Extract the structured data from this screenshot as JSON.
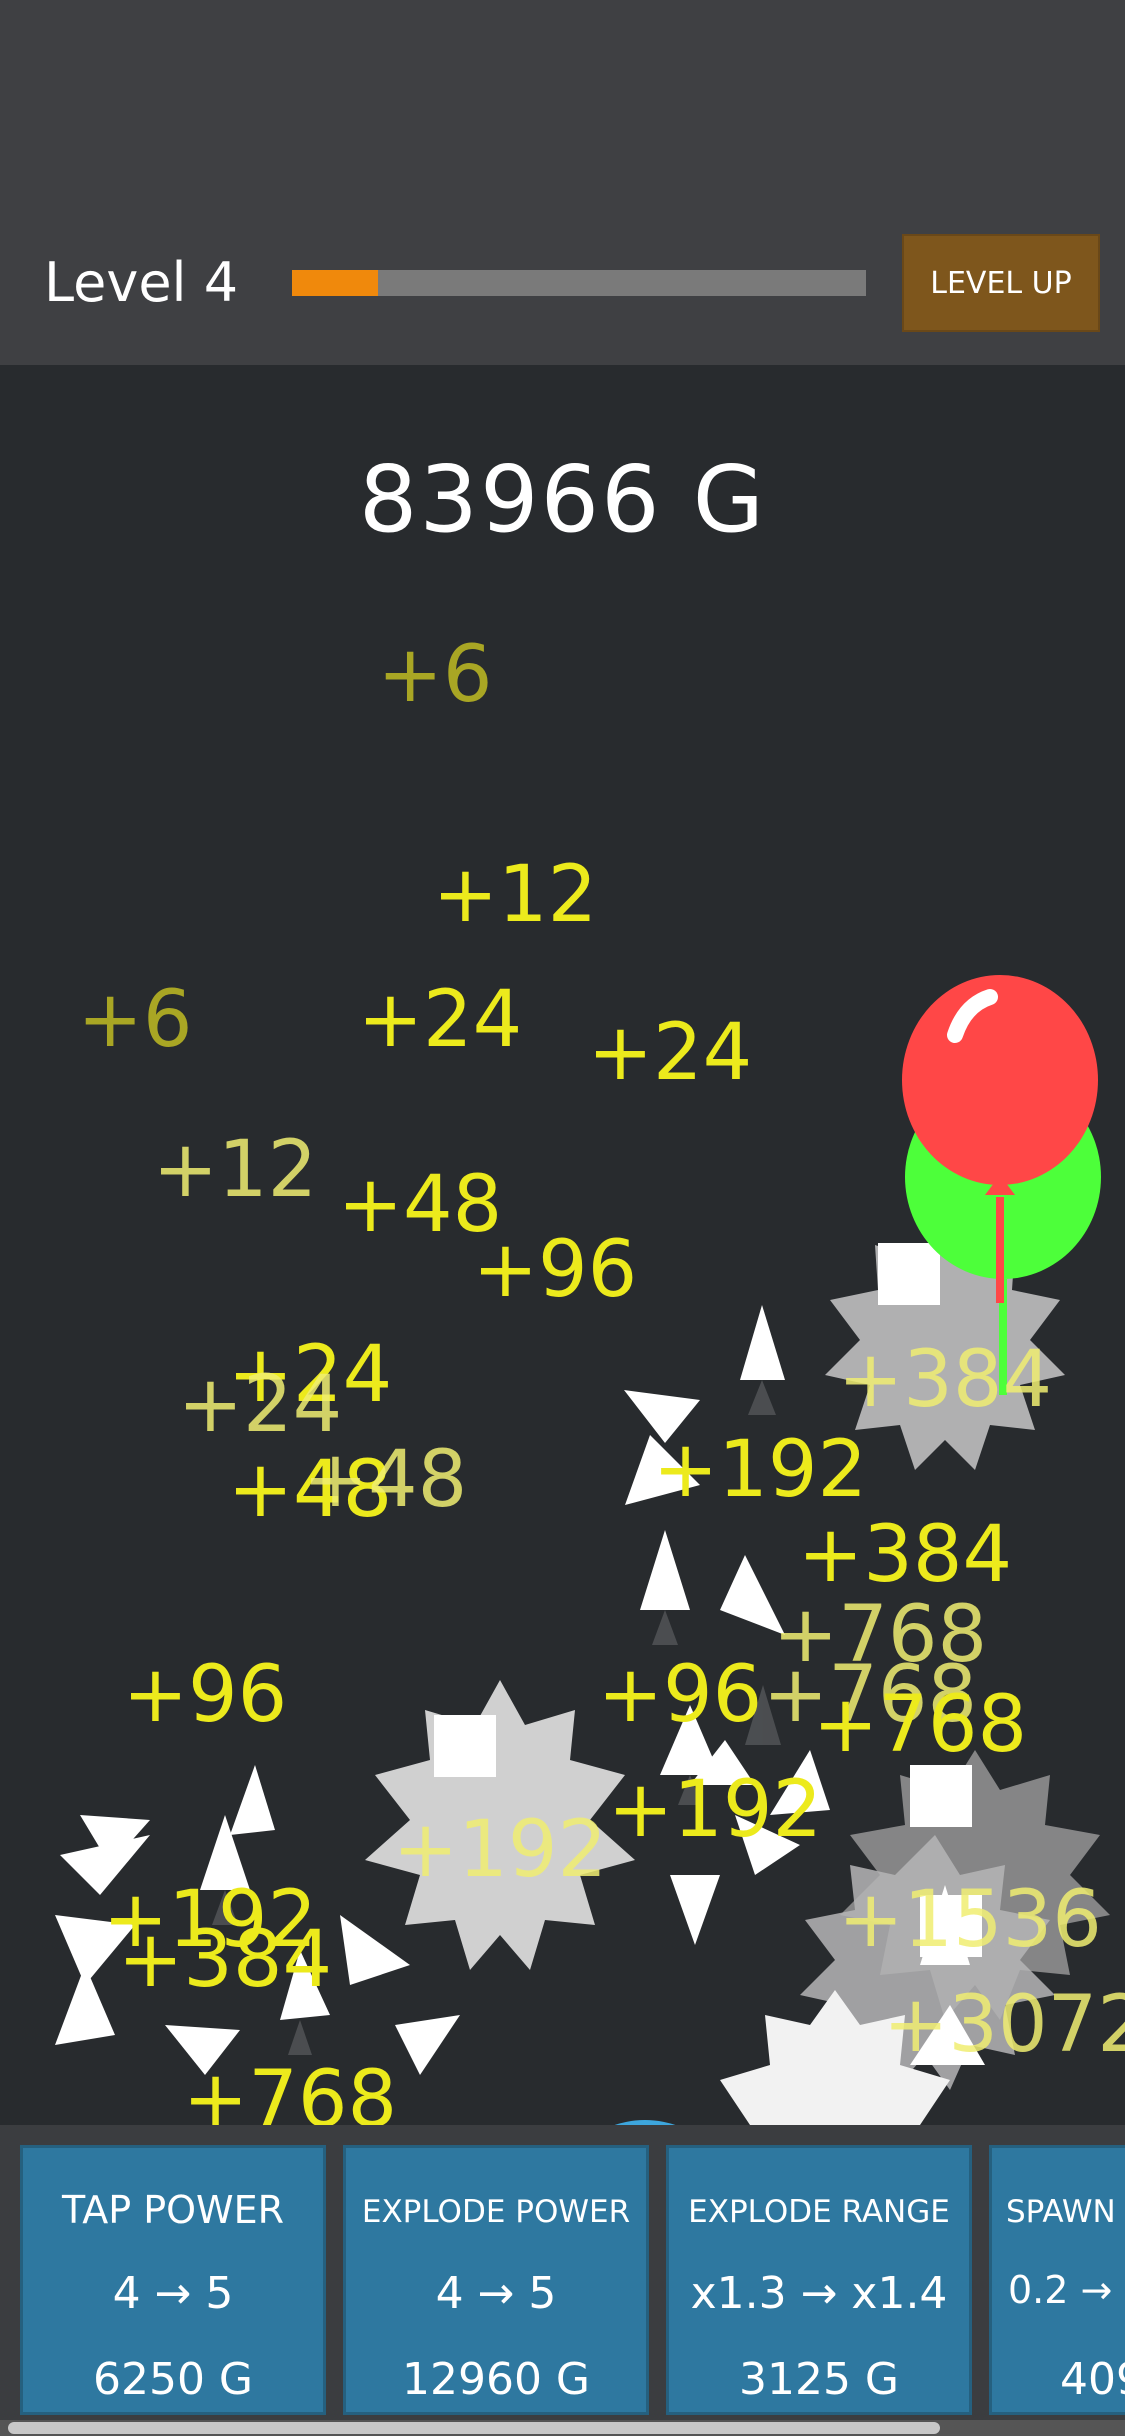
{
  "header": {
    "level_label": "Level 4",
    "level_progress": 0.15,
    "level_up_label": "LEVEL UP"
  },
  "gold": "83966 G",
  "popups": [
    "+6",
    "+12",
    "+6",
    "+24",
    "+24",
    "+12",
    "+48",
    "+96",
    "+24",
    "+24",
    "+48",
    "+48",
    "+384",
    "+192",
    "+384",
    "+768",
    "+96",
    "+768",
    "+768",
    "+96",
    "+192",
    "+192",
    "+1536",
    "+192",
    "+384",
    "+3072",
    "+768"
  ],
  "balloons": [
    {
      "color": "#ff4747",
      "icon": "balloon-icon"
    },
    {
      "color": "#4dff3a",
      "icon": "balloon-icon"
    }
  ],
  "upgrades": [
    {
      "title": "TAP POWER",
      "value": "4 → 5",
      "cost": "6250 G"
    },
    {
      "title": "EXPLODE POWER",
      "value": "4 → 5",
      "cost": "12960 G"
    },
    {
      "title": "EXPLODE RANGE",
      "value": "x1.3 → x1.4",
      "cost": "3125 G"
    },
    {
      "title": "SPAWN",
      "value": "0.2 →",
      "cost": "409"
    }
  ],
  "colors": {
    "background": "#282b2e",
    "header": "#3f4043",
    "progress_fill": "#f0890c",
    "level_up_button": "#7e561c",
    "card": "#2e78a0",
    "popup_text": "#ecea1c"
  }
}
